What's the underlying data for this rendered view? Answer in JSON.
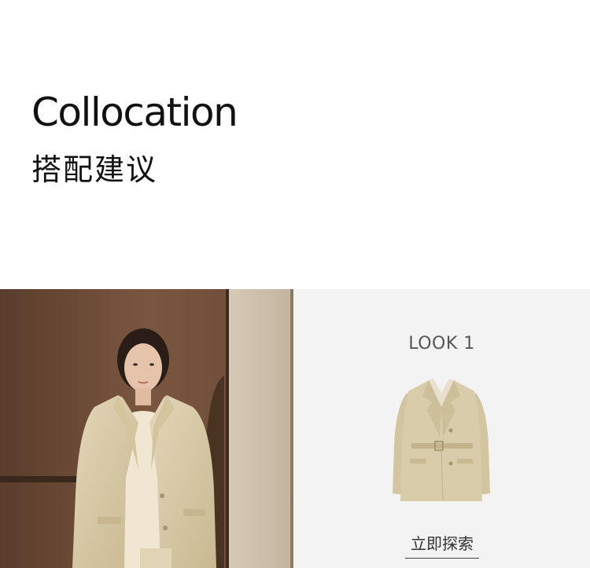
{
  "header": {
    "title_en": "Collocation",
    "title_zh": "搭配建议"
  },
  "look": {
    "label": "LOOK 1",
    "cta_label": "立即探索",
    "garment_icon": "beige-blazer-with-belt",
    "garment_color": "#d9ccaa"
  },
  "photo": {
    "description_icon": "model-in-beige-blazer-photo"
  },
  "colors": {
    "background": "#ffffff",
    "panel_background": "#f3f3f3",
    "text": "#111111"
  }
}
